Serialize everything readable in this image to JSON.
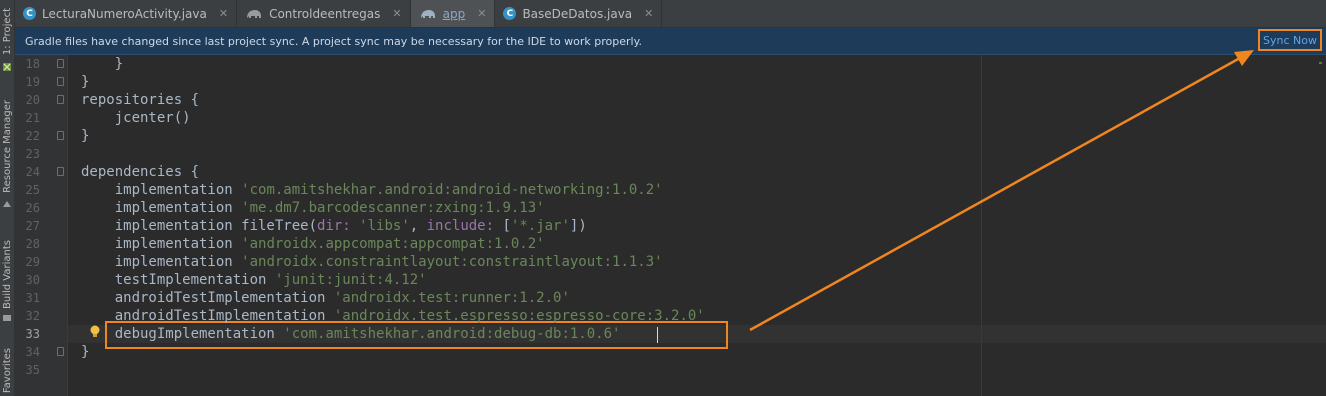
{
  "tool_windows": [
    {
      "label": "1: Project",
      "icon": "android-project-icon"
    },
    {
      "label": "Resource Manager",
      "icon": "resource-manager-icon"
    },
    {
      "label": "Build Variants",
      "icon": "build-variants-icon"
    },
    {
      "label": "Favorites",
      "icon": "favorites-star-icon"
    }
  ],
  "tabs": [
    {
      "label": "LecturaNumeroActivity.java",
      "icon": "class-icon",
      "icon_text": "C",
      "active": false
    },
    {
      "label": "Controldeentregas",
      "icon": "gradle-elephant-icon",
      "active": false
    },
    {
      "label": "app",
      "icon": "gradle-elephant-icon",
      "active": true
    },
    {
      "label": "BaseDeDatos.java",
      "icon": "class-icon",
      "icon_text": "C",
      "active": false
    }
  ],
  "close_glyph": "✕",
  "banner": {
    "message": "Gradle files have changed since last project sync. A project sync may be necessary for the IDE to work properly.",
    "action": "Sync Now"
  },
  "editor": {
    "current_line": 33,
    "lines": [
      {
        "n": "18",
        "t": "    }"
      },
      {
        "n": "19",
        "t": "}"
      },
      {
        "n": "20",
        "t": "repositories {"
      },
      {
        "n": "21",
        "t": "    jcenter()"
      },
      {
        "n": "22",
        "t": "}"
      },
      {
        "n": "23",
        "t": ""
      },
      {
        "n": "24",
        "t": "dependencies {"
      },
      {
        "n": "25",
        "a": "    implementation ",
        "s": "'com.amitshekhar.android:android-networking:1.0.2'"
      },
      {
        "n": "26",
        "a": "    implementation ",
        "s": "'me.dm7.barcodescanner:zxing:1.9.13'"
      },
      {
        "n": "27",
        "a": "    implementation fileTree(",
        "p1": "dir: ",
        "s1": "'libs'",
        "m": ", ",
        "p2": "include: ",
        "z": "[",
        "s2": "'*.jar'",
        "e": "])"
      },
      {
        "n": "28",
        "a": "    implementation ",
        "s": "'androidx.appcompat:appcompat:1.0.2'"
      },
      {
        "n": "29",
        "a": "    implementation ",
        "s": "'androidx.constraintlayout:constraintlayout:1.1.3'"
      },
      {
        "n": "30",
        "a": "    testImplementation ",
        "s": "'junit:junit:4.12'"
      },
      {
        "n": "31",
        "a": "    androidTestImplementation ",
        "s": "'androidx.test:runner:1.2.0'"
      },
      {
        "n": "32",
        "a": "    androidTestImplementation ",
        "s": "'androidx.test.espresso:espresso-core:3.2.0'"
      },
      {
        "n": "33",
        "a": "    debugImplementation ",
        "s": "'com.amitshekhar.android:debug-db:1.0.6'"
      },
      {
        "n": "34",
        "t": "}"
      },
      {
        "n": "35",
        "t": ""
      }
    ]
  },
  "colors": {
    "annotation": "#f0861f",
    "string": "#6a8759",
    "text": "#a9b7c6",
    "banner_bg": "#1e3b5a",
    "link": "#5fa5e8"
  }
}
